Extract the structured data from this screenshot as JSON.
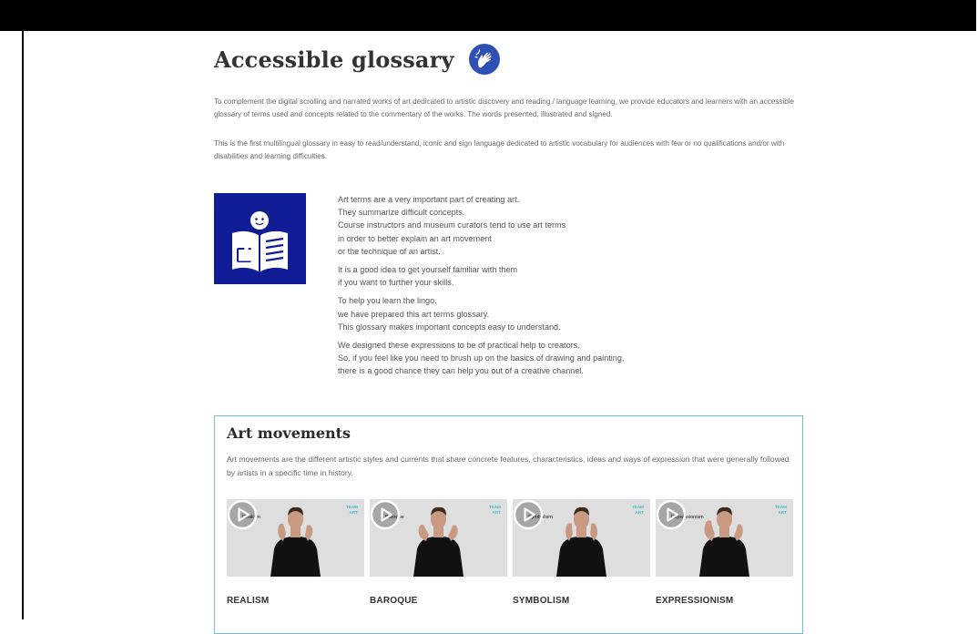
{
  "header": {
    "title": "Accessible glossary",
    "icon": "sign-language-icon",
    "icon_color": "#2e4fb4"
  },
  "intro": [
    "To complement the digital scrolling and narrated works of art dedicated to artistic discovery and reading / language learning, we provide educators and learners with an accessible glossary of terms used and concepts related to the commentary of the works. The words presented, illustrated and signed.",
    "This is the first multilingual glossary in easy to read/understand, iconic and sign language dedicated to artistic vocabulary for audiences with few or no qualifications and/or with disabilities and learning difficulties."
  ],
  "easy_read": {
    "logo_icon": "easy-to-read-icon",
    "logo_color": "#0f1c96",
    "paragraphs": [
      [
        "Art terms are a very important part of creating art.",
        "They summarize difficult concepts.",
        "Course instructors and museum curators tend to use art terms",
        "in order to better explain an art movement",
        "or the technique of an artist."
      ],
      [
        "It is a good idea to get yourself familiar with them",
        "if you want to further your skills."
      ],
      [
        "To help you learn the lingo,",
        "we have prepared this art terms glossary.",
        "This glossary makes important concepts easy to understand."
      ],
      [
        "We designed these expressions to be of practical help to creators.",
        "So, if you feel like you need to brush up on the basics of drawing and painting,",
        "there is a good chance they can help you out of a creative channel."
      ]
    ]
  },
  "art_movements": {
    "title": "Art movements",
    "description": "Art movements are the different artistic styles and currents that share concrete features, characteristics, ideas and ways of expression that were generally followed by artists in a specific time in history.",
    "border_color": "#6ec2d0",
    "brand_lines": [
      "TEAM",
      "ART"
    ],
    "items": [
      {
        "video_label": "Realism",
        "name": "REALISM"
      },
      {
        "video_label": "Baroque",
        "name": "BAROQUE"
      },
      {
        "video_label": "Symbolism",
        "name": "SYMBOLISM"
      },
      {
        "video_label": "Expressionism",
        "name": "EXPRESSIONISM"
      }
    ]
  }
}
